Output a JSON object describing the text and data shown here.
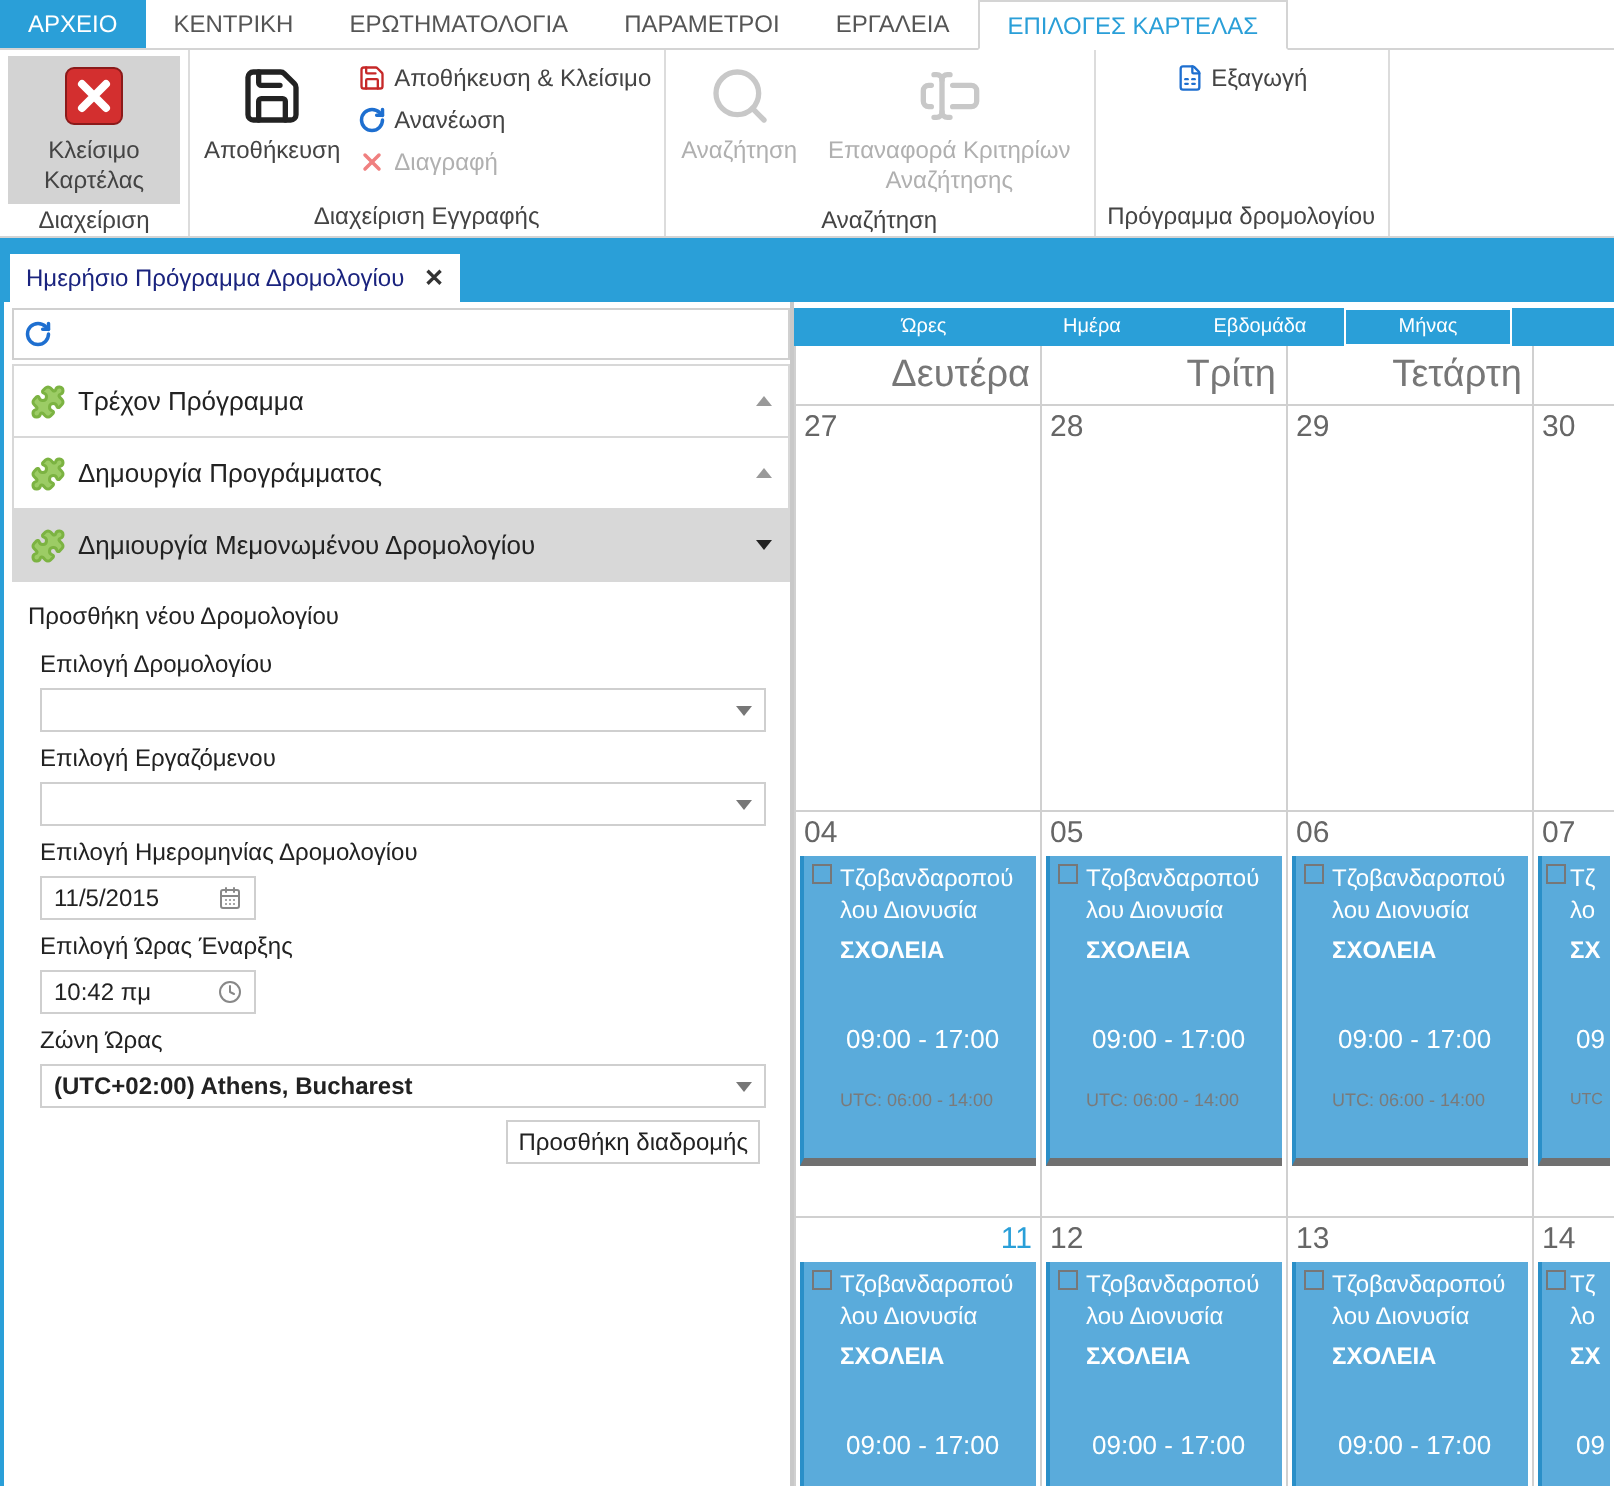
{
  "ribbon_tabs": [
    {
      "label": "ΑΡΧΕΙΟ",
      "kind": "file",
      "selected": false
    },
    {
      "label": "ΚΕΝΤΡΙΚΗ",
      "kind": "tab",
      "selected": false
    },
    {
      "label": "ΕΡΩΤΗΜΑΤΟΛΟΓΙΑ",
      "kind": "tab",
      "selected": false
    },
    {
      "label": "ΠΑΡΑΜΕΤΡΟΙ",
      "kind": "tab",
      "selected": false
    },
    {
      "label": "ΕΡΓΑΛΕΙΑ",
      "kind": "tab",
      "selected": false
    },
    {
      "label": "ΕΠΙΛΟΓΕΣ ΚΑΡΤΕΛΑΣ",
      "kind": "tab",
      "selected": true
    }
  ],
  "ribbon_groups": [
    {
      "label": "Διαχείριση",
      "buttons": [
        {
          "label": "Κλείσιμο Καρτέλας",
          "kind": "large",
          "disabled": false,
          "pressed": true
        }
      ]
    },
    {
      "label": "Διαχείριση Εγγραφής",
      "buttons": [
        {
          "label": "Αποθήκευση",
          "kind": "large",
          "disabled": false,
          "pressed": false
        },
        {
          "label": "Αποθήκευση & Κλείσιμο",
          "kind": "small",
          "disabled": false,
          "pressed": false
        },
        {
          "label": "Ανανέωση",
          "kind": "small",
          "disabled": false,
          "pressed": false
        },
        {
          "label": "Διαγραφή",
          "kind": "small",
          "disabled": true,
          "pressed": false
        }
      ]
    },
    {
      "label": "Αναζήτηση",
      "buttons": [
        {
          "label": "Αναζήτηση",
          "kind": "large",
          "disabled": true,
          "pressed": false
        },
        {
          "label": "Επαναφορά Κριτηρίων Αναζήτησης",
          "kind": "large",
          "disabled": true,
          "pressed": false
        }
      ]
    },
    {
      "label": "Πρόγραμμα δρομολογίου",
      "buttons": [
        {
          "label": "Εξαγωγή",
          "kind": "small",
          "disabled": false,
          "pressed": false
        }
      ]
    }
  ],
  "document_tab": {
    "title": "Ημερήσιο Πρόγραμμα Δρομολογίου",
    "close": "✕"
  },
  "accordion": [
    {
      "title": "Τρέχον Πρόγραμμα",
      "expanded": false
    },
    {
      "title": "Δημουργία Προγράμματος",
      "expanded": false
    },
    {
      "title": "Δημιουργία Μεμονωμένου Δρομολογίου",
      "expanded": true
    }
  ],
  "form": {
    "title": "Προσθήκη νέου Δρομολογίου",
    "fields": [
      {
        "label": "Επιλογή Δρομολογίου",
        "kind": "select"
      },
      {
        "label": "Επιλογή Εργαζόμενου",
        "kind": "select"
      },
      {
        "label": "Επιλογή Ημερομηνίας Δρομολογίου",
        "kind": "date",
        "value": "11/5/2015"
      },
      {
        "label": "Επιλογή Ώρας Έναρξης",
        "kind": "time",
        "value": "10:42 πμ"
      },
      {
        "label": "Ζώνη Ώρας",
        "kind": "select",
        "value": "(UTC+02:00) Athens, Bucharest"
      }
    ],
    "button": "Προσθήκη διαδρομής"
  },
  "calendar": {
    "views": [
      {
        "label": "Ώρες",
        "selected": false
      },
      {
        "label": "Ημέρα",
        "selected": false
      },
      {
        "label": "Εβδομάδα",
        "selected": false
      },
      {
        "label": "Μήνας",
        "selected": true
      }
    ],
    "weekdays": [
      "Δευτέρα",
      "Τρίτη",
      "Τετάρτη"
    ],
    "weeks": [
      {
        "days": [
          {
            "number": "27",
            "today": false
          },
          {
            "number": "28",
            "today": false
          },
          {
            "number": "29",
            "today": false
          },
          {
            "number": "30",
            "today": false
          }
        ]
      },
      {
        "days": [
          {
            "number": "04",
            "today": false,
            "events": [
              {
                "checked": false,
                "name": "Τζοβανδαροπού λου Διονυσία",
                "category": "ΣΧΟΛΕΙΑ",
                "time": "09:00 -  17:00",
                "utc": "UTC: 06:00 -  14:00"
              }
            ]
          },
          {
            "number": "05",
            "today": false,
            "events": [
              {
                "checked": false,
                "name": "Τζοβανδαροπού λου Διονυσία",
                "category": "ΣΧΟΛΕΙΑ",
                "time": "09:00 -  17:00",
                "utc": "UTC: 06:00 -  14:00"
              }
            ]
          },
          {
            "number": "06",
            "today": false,
            "events": [
              {
                "checked": false,
                "name": "Τζοβανδαροπού λου Διονυσία",
                "category": "ΣΧΟΛΕΙΑ",
                "time": "09:00 -  17:00",
                "utc": "UTC: 06:00 -  14:00"
              }
            ]
          },
          {
            "number": "07",
            "today": false,
            "events": [
              {
                "checked": false,
                "name": "Τζ λο",
                "category": "ΣΧ",
                "time": "09",
                "utc": "UTC"
              }
            ]
          }
        ]
      },
      {
        "days": [
          {
            "number": "11",
            "today": true,
            "events": [
              {
                "checked": false,
                "name": "Τζοβανδαροπού λου Διονυσία",
                "category": "ΣΧΟΛΕΙΑ",
                "time": "09:00 -  17:00"
              }
            ]
          },
          {
            "number": "12",
            "today": false,
            "events": [
              {
                "checked": false,
                "name": "Τζοβανδαροπού λου Διονυσία",
                "category": "ΣΧΟΛΕΙΑ",
                "time": "09:00 -  17:00"
              }
            ]
          },
          {
            "number": "13",
            "today": false,
            "events": [
              {
                "checked": false,
                "name": "Τζοβανδαροπού λου Διονυσία",
                "category": "ΣΧΟΛΕΙΑ",
                "time": "09:00 -  17:00"
              }
            ]
          },
          {
            "number": "14",
            "today": false,
            "events": [
              {
                "checked": false,
                "name": "Τζ λο",
                "category": "ΣΧ",
                "time": "09"
              }
            ]
          }
        ]
      }
    ]
  }
}
